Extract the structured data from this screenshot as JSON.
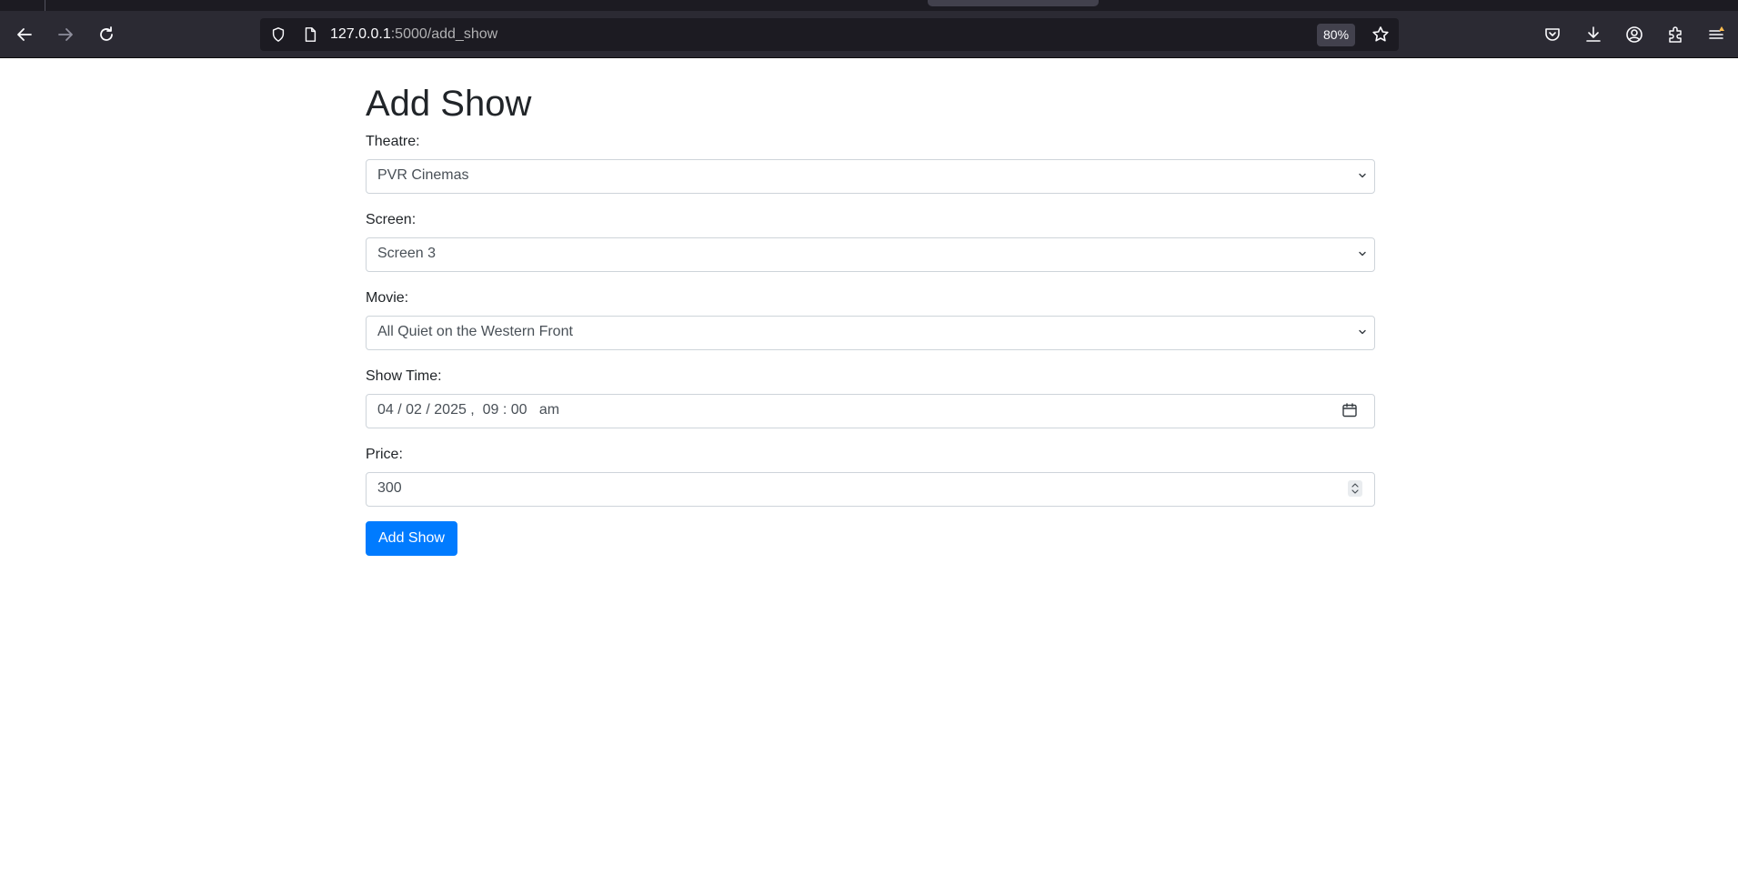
{
  "browser": {
    "url_host": "127.0.0.1",
    "url_rest": ":5000/add_show",
    "zoom": "80%",
    "icons": [
      "back-icon",
      "forward-icon",
      "reload-icon",
      "shield-icon",
      "page-icon",
      "star-icon",
      "pocket-icon",
      "download-icon",
      "account-icon",
      "extensions-icon",
      "menu-icon"
    ]
  },
  "page": {
    "title": "Add Show",
    "submit_label": "Add Show"
  },
  "form": {
    "theatre_label": "Theatre:",
    "theatre_value": "PVR Cinemas",
    "screen_label": "Screen:",
    "screen_value": "Screen 3",
    "movie_label": "Movie:",
    "movie_value": "All Quiet on the Western Front",
    "showtime_label": "Show Time:",
    "showtime_value": "04 / 02 / 2025 ,  09 : 00   am",
    "price_label": "Price:",
    "price_value": "300"
  },
  "colors": {
    "primary": "#007bff",
    "chrome_bg": "#2b2a33",
    "urlbar_bg": "#1c1b22"
  }
}
